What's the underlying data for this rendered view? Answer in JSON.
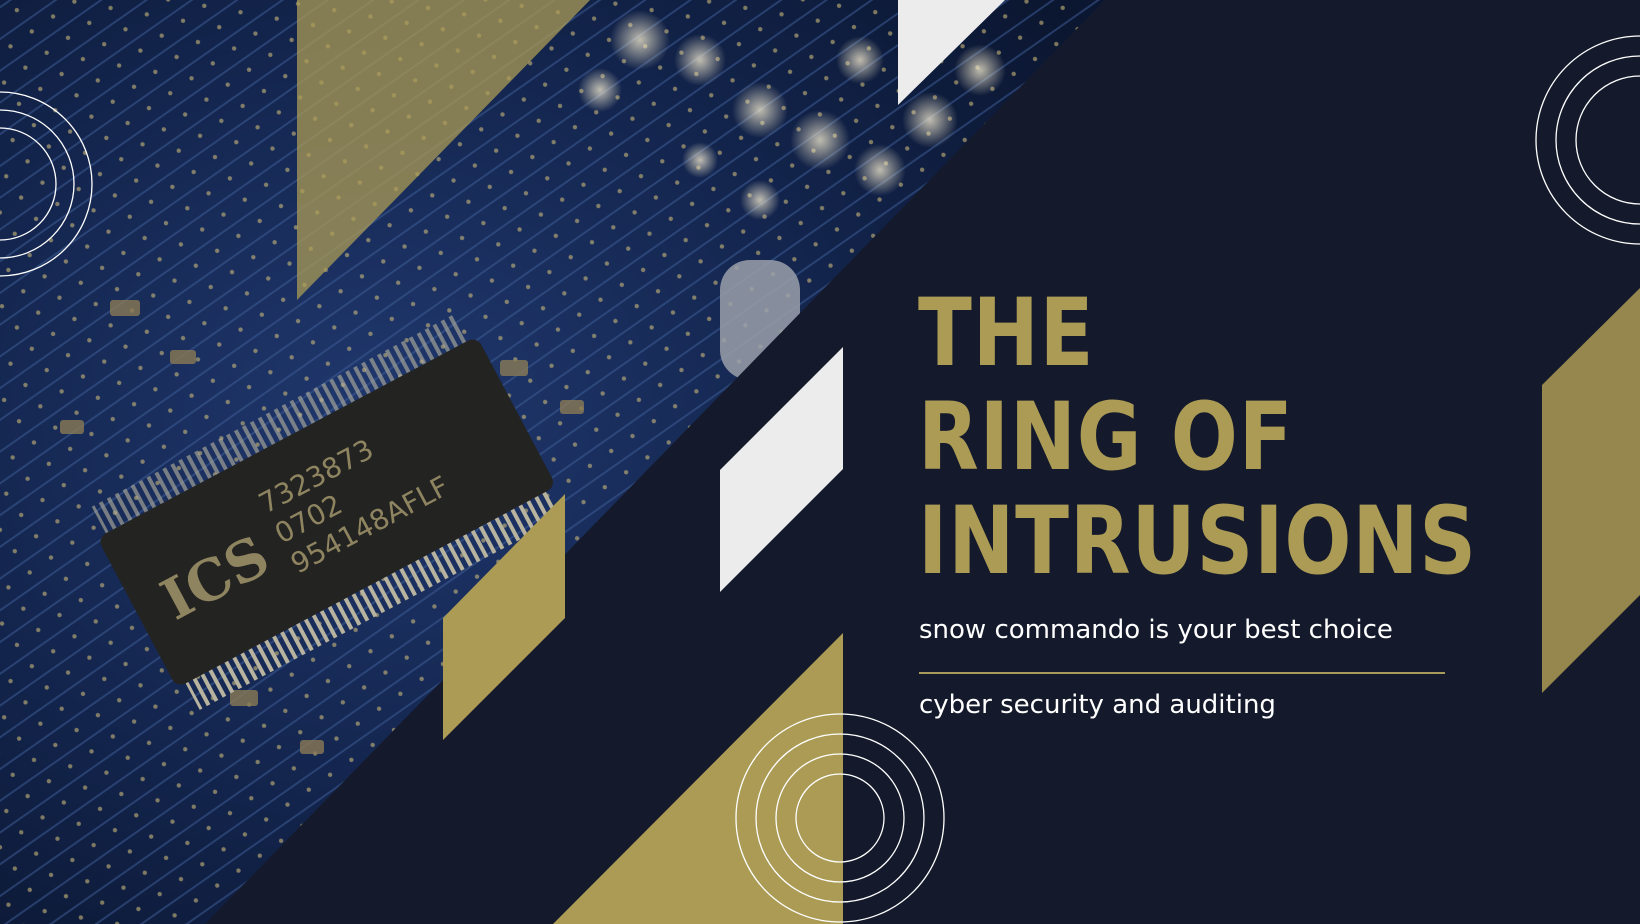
{
  "slide": {
    "title_lines": [
      "THE",
      "RING OF",
      "INTRUSIONS"
    ],
    "subtitle": "snow commando is your best choice",
    "tagline": "cyber security and auditing",
    "chip_marking": {
      "logo": "ICS",
      "lines": [
        "7323873",
        "0702",
        "954148AFLF"
      ]
    }
  },
  "colors": {
    "navy": "#141a2b",
    "gold": "#ab9b55",
    "white": "#ffffff",
    "light_gray": "#ececec"
  },
  "icons": [
    "concentric-rings-icon"
  ]
}
